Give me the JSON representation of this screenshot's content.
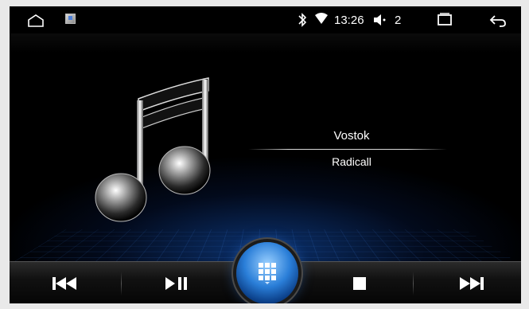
{
  "status_bar": {
    "time": "13:26",
    "volume_level": "2",
    "icons": [
      "home-icon",
      "app-thumbnail-icon",
      "bluetooth-icon",
      "wifi-icon",
      "volume-icon",
      "recent-apps-icon",
      "back-icon"
    ]
  },
  "track": {
    "title": "Vostok",
    "artist": "Radicall"
  },
  "controls": {
    "items": [
      "previous-track",
      "play-pause",
      "menu",
      "stop",
      "next-track"
    ]
  },
  "colors": {
    "accent": "#2a7ed8",
    "background": "#000000",
    "text": "#ffffff"
  }
}
